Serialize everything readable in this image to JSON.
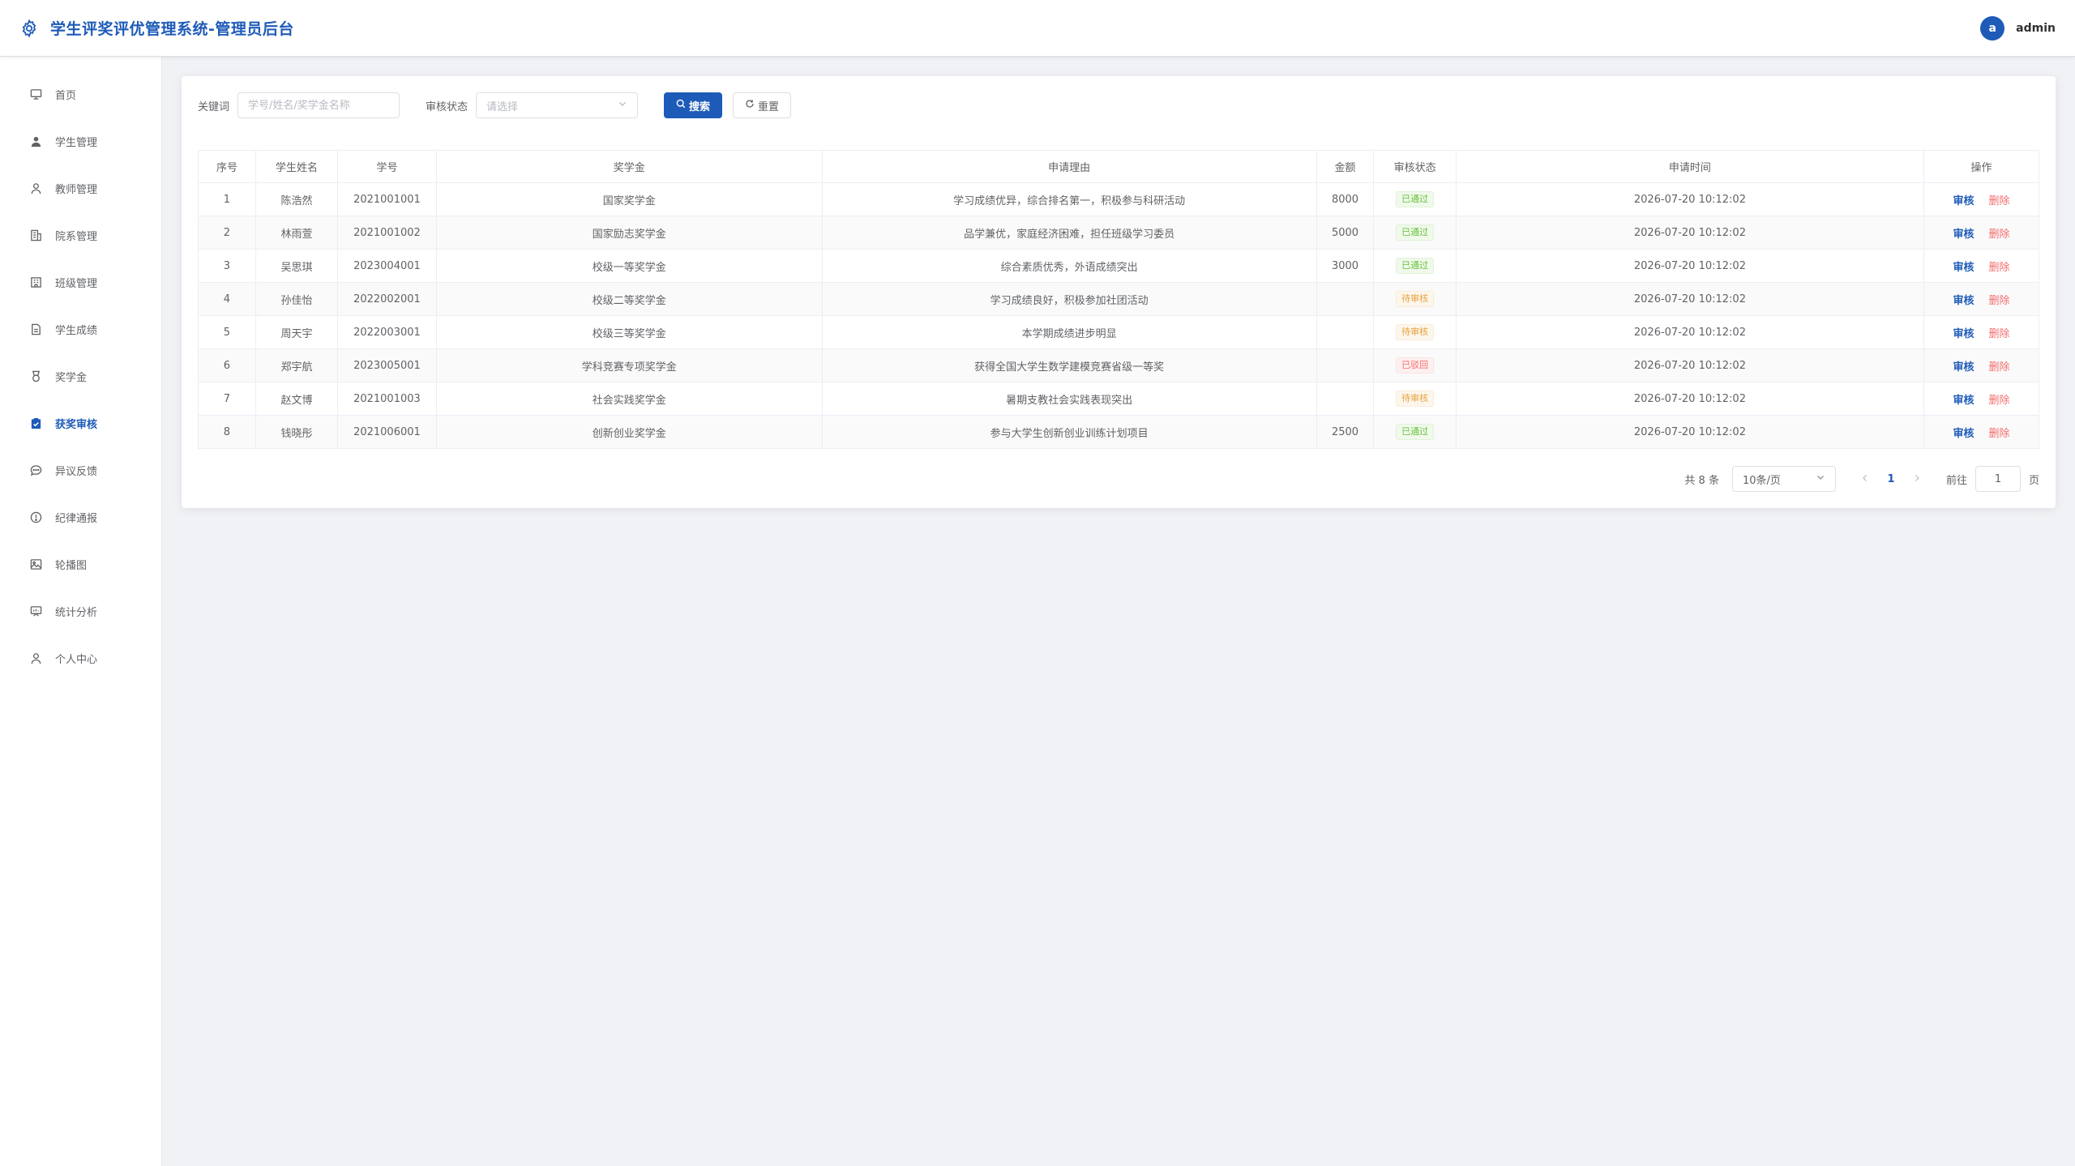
{
  "header": {
    "title": "学生评奖评优管理系统-管理员后台",
    "avatar_letter": "a",
    "username": "admin"
  },
  "sidebar": {
    "items": [
      {
        "label": "首页",
        "icon": "monitor-icon"
      },
      {
        "label": "学生管理",
        "icon": "user-filled-icon"
      },
      {
        "label": "教师管理",
        "icon": "user-icon"
      },
      {
        "label": "院系管理",
        "icon": "building-icon"
      },
      {
        "label": "班级管理",
        "icon": "office-building-icon"
      },
      {
        "label": "学生成绩",
        "icon": "document-icon"
      },
      {
        "label": "奖学金",
        "icon": "medal-icon"
      },
      {
        "label": "获奖审核",
        "icon": "checked-icon"
      },
      {
        "label": "异议反馈",
        "icon": "chat-icon"
      },
      {
        "label": "纪律通报",
        "icon": "warning-icon"
      },
      {
        "label": "轮播图",
        "icon": "picture-icon"
      },
      {
        "label": "统计分析",
        "icon": "data-board-icon"
      },
      {
        "label": "个人中心",
        "icon": "user-icon"
      }
    ],
    "active_index": 7
  },
  "search": {
    "keyword_label": "关键词",
    "keyword_placeholder": "学号/姓名/奖学金名称",
    "keyword_value": "",
    "status_label": "审核状态",
    "status_placeholder": "请选择",
    "search_button": "搜索",
    "reset_button": "重置"
  },
  "table": {
    "columns": [
      "序号",
      "学生姓名",
      "学号",
      "奖学金",
      "申请理由",
      "金额",
      "审核状态",
      "申请时间",
      "操作"
    ],
    "rows": [
      {
        "no": "1",
        "name": "陈浩然",
        "sid": "2021001001",
        "scholarship": "国家奖学金",
        "reason": "学习成绩优异，综合排名第一，积极参与科研活动",
        "amount": "8000",
        "status": "已通过",
        "status_type": "pass",
        "time": "2026-07-20 10:12:02"
      },
      {
        "no": "2",
        "name": "林雨萱",
        "sid": "2021001002",
        "scholarship": "国家励志奖学金",
        "reason": "品学兼优，家庭经济困难，担任班级学习委员",
        "amount": "5000",
        "status": "已通过",
        "status_type": "pass",
        "time": "2026-07-20 10:12:02"
      },
      {
        "no": "3",
        "name": "吴思琪",
        "sid": "2023004001",
        "scholarship": "校级一等奖学金",
        "reason": "综合素质优秀，外语成绩突出",
        "amount": "3000",
        "status": "已通过",
        "status_type": "pass",
        "time": "2026-07-20 10:12:02"
      },
      {
        "no": "4",
        "name": "孙佳怡",
        "sid": "2022002001",
        "scholarship": "校级二等奖学金",
        "reason": "学习成绩良好，积极参加社团活动",
        "amount": "",
        "status": "待审核",
        "status_type": "pending",
        "time": "2026-07-20 10:12:02"
      },
      {
        "no": "5",
        "name": "周天宇",
        "sid": "2022003001",
        "scholarship": "校级三等奖学金",
        "reason": "本学期成绩进步明显",
        "amount": "",
        "status": "待审核",
        "status_type": "pending",
        "time": "2026-07-20 10:12:02"
      },
      {
        "no": "6",
        "name": "郑宇航",
        "sid": "2023005001",
        "scholarship": "学科竞赛专项奖学金",
        "reason": "获得全国大学生数学建模竞赛省级一等奖",
        "amount": "",
        "status": "已驳回",
        "status_type": "reject",
        "time": "2026-07-20 10:12:02"
      },
      {
        "no": "7",
        "name": "赵文博",
        "sid": "2021001003",
        "scholarship": "社会实践奖学金",
        "reason": "暑期支教社会实践表现突出",
        "amount": "",
        "status": "待审核",
        "status_type": "pending",
        "time": "2026-07-20 10:12:02"
      },
      {
        "no": "8",
        "name": "钱晓彤",
        "sid": "2021006001",
        "scholarship": "创新创业奖学金",
        "reason": "参与大学生创新创业训练计划项目",
        "amount": "2500",
        "status": "已通过",
        "status_type": "pass",
        "time": "2026-07-20 10:12:02"
      }
    ],
    "actions": {
      "review": "审核",
      "delete": "删除"
    }
  },
  "pagination": {
    "total_text": "共 8 条",
    "page_size": "10条/页",
    "current_page": "1",
    "goto_label": "前往",
    "goto_value": "1",
    "goto_unit": "页"
  },
  "colors": {
    "primary": "#1e5bb8",
    "success": "#67c23a",
    "warning": "#e6a23c",
    "danger": "#f56c6c"
  }
}
